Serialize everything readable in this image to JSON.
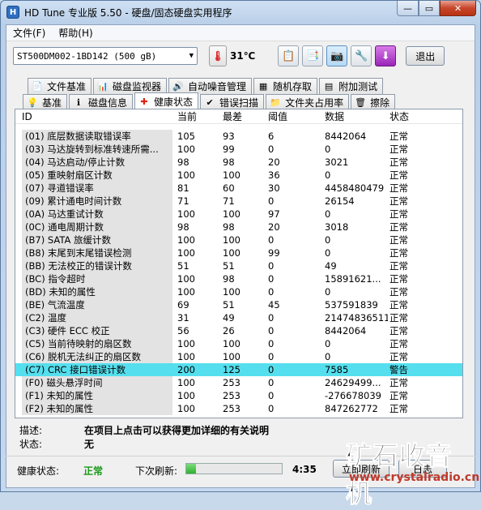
{
  "window": {
    "title": "HD Tune 专业版 5.50 - 硬盘/固态硬盘实用程序",
    "min": "—",
    "max": "▭",
    "close": "✕"
  },
  "menu": {
    "file": "文件(F)",
    "help": "帮助(H)"
  },
  "toolbar": {
    "drive": "ST500DM002-1BD142 (500 gB)",
    "temp": "31℃",
    "exit": "退出"
  },
  "tabs_top": [
    {
      "label": "文件基准",
      "icon": "file-benchmark-icon"
    },
    {
      "label": "磁盘监视器",
      "icon": "disk-monitor-icon"
    },
    {
      "label": "自动噪音管理",
      "icon": "speaker-icon"
    },
    {
      "label": "随机存取",
      "icon": "random-access-icon"
    },
    {
      "label": "附加测试",
      "icon": "extra-tests-icon"
    }
  ],
  "tabs_bottom": [
    {
      "label": "基准",
      "icon": "benchmark-icon"
    },
    {
      "label": "磁盘信息",
      "icon": "info-icon"
    },
    {
      "label": "健康状态",
      "icon": "health-icon"
    },
    {
      "label": "错误扫描",
      "icon": "scan-icon"
    },
    {
      "label": "文件夹占用率",
      "icon": "folder-icon"
    },
    {
      "label": "擦除",
      "icon": "trash-icon"
    }
  ],
  "table": {
    "headers": {
      "id": "ID",
      "current": "当前",
      "worst": "最差",
      "threshold": "阈值",
      "data": "数据",
      "status": "状态"
    },
    "rows": [
      {
        "id": "(01) 底层数据读取错误率",
        "current": "105",
        "worst": "93",
        "threshold": "6",
        "data": "8442064",
        "status": "正常"
      },
      {
        "id": "(03) 马达旋转到标准转速所需...",
        "current": "100",
        "worst": "99",
        "threshold": "0",
        "data": "0",
        "status": "正常"
      },
      {
        "id": "(04) 马达启动/停止计数",
        "current": "98",
        "worst": "98",
        "threshold": "20",
        "data": "3021",
        "status": "正常"
      },
      {
        "id": "(05) 重映射扇区计数",
        "current": "100",
        "worst": "100",
        "threshold": "36",
        "data": "0",
        "status": "正常"
      },
      {
        "id": "(07) 寻道错误率",
        "current": "81",
        "worst": "60",
        "threshold": "30",
        "data": "4458480479",
        "status": "正常"
      },
      {
        "id": "(09) 累计通电时间计数",
        "current": "71",
        "worst": "71",
        "threshold": "0",
        "data": "26154",
        "status": "正常"
      },
      {
        "id": "(0A) 马达重试计数",
        "current": "100",
        "worst": "100",
        "threshold": "97",
        "data": "0",
        "status": "正常"
      },
      {
        "id": "(0C) 通电周期计数",
        "current": "98",
        "worst": "98",
        "threshold": "20",
        "data": "3018",
        "status": "正常"
      },
      {
        "id": "(B7) SATA 旅缓计数",
        "current": "100",
        "worst": "100",
        "threshold": "0",
        "data": "0",
        "status": "正常"
      },
      {
        "id": "(B8) 末尾到末尾错误检测",
        "current": "100",
        "worst": "100",
        "threshold": "99",
        "data": "0",
        "status": "正常"
      },
      {
        "id": "(BB) 无法校正的错误计数",
        "current": "51",
        "worst": "51",
        "threshold": "0",
        "data": "49",
        "status": "正常"
      },
      {
        "id": "(BC) 指令超时",
        "current": "100",
        "worst": "98",
        "threshold": "0",
        "data": "15891621...",
        "status": "正常"
      },
      {
        "id": "(BD) 未知的属性",
        "current": "100",
        "worst": "100",
        "threshold": "0",
        "data": "0",
        "status": "正常"
      },
      {
        "id": "(BE) 气流温度",
        "current": "69",
        "worst": "51",
        "threshold": "45",
        "data": "537591839",
        "status": "正常"
      },
      {
        "id": "(C2) 温度",
        "current": "31",
        "worst": "49",
        "threshold": "0",
        "data": "21474836511",
        "status": "正常"
      },
      {
        "id": "(C3) 硬件 ECC 校正",
        "current": "56",
        "worst": "26",
        "threshold": "0",
        "data": "8442064",
        "status": "正常"
      },
      {
        "id": "(C5) 当前待映射的扇区数",
        "current": "100",
        "worst": "100",
        "threshold": "0",
        "data": "0",
        "status": "正常"
      },
      {
        "id": "(C6) 脱机无法纠正的扇区数",
        "current": "100",
        "worst": "100",
        "threshold": "0",
        "data": "0",
        "status": "正常"
      },
      {
        "id": "(C7) CRC 接口错误计数",
        "current": "200",
        "worst": "125",
        "threshold": "0",
        "data": "7585",
        "status": "警告"
      },
      {
        "id": "(F0) 磁头悬浮时间",
        "current": "100",
        "worst": "253",
        "threshold": "0",
        "data": "24629499...",
        "status": "正常"
      },
      {
        "id": "(F1) 未知的属性",
        "current": "100",
        "worst": "253",
        "threshold": "0",
        "data": "-276678039",
        "status": "正常"
      },
      {
        "id": "(F2) 未知的属性",
        "current": "100",
        "worst": "253",
        "threshold": "0",
        "data": "847262772",
        "status": "正常"
      }
    ]
  },
  "info": {
    "desc_label": "描述:",
    "desc_value": "在项目上点击可以获得更加详细的有关说明",
    "status_label": "状态:",
    "status_value": "无"
  },
  "statusbar": {
    "health_label": "健康状态:",
    "health_value": "正常",
    "refresh_label": "下次刷新:",
    "refresh_progress": 0.1,
    "timer": "4:35",
    "refresh_btn": "立即刷新",
    "log_btn": "日志"
  },
  "watermark": {
    "big": "矿石收音机",
    "small": "www.crystalradio.cn"
  },
  "colors": {
    "highlight_row": "#55dfee",
    "health_ok": "#1a9a1a"
  }
}
